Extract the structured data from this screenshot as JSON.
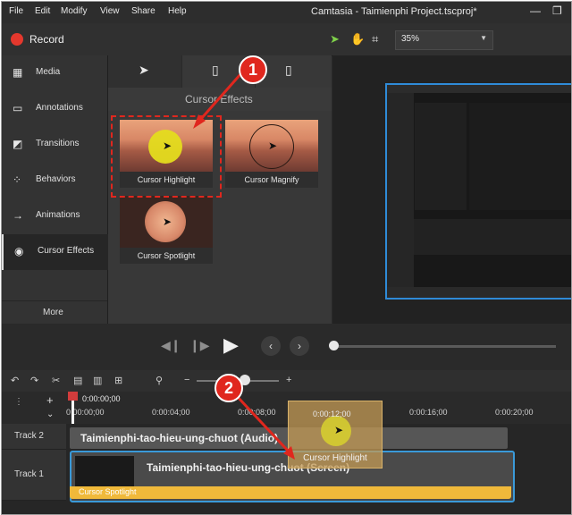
{
  "menubar": {
    "items": [
      "File",
      "Edit",
      "Modify",
      "View",
      "Share",
      "Help"
    ],
    "title": "Camtasia - Taimienphi Project.tscproj*",
    "controls": [
      "—",
      "❐"
    ]
  },
  "toolbar": {
    "record_label": "Record",
    "zoom_value": "35%",
    "tools": [
      "pointer-icon",
      "hand-icon",
      "crop-icon"
    ]
  },
  "sidebar": {
    "items": [
      {
        "label": "Media",
        "icon": "film-icon"
      },
      {
        "label": "Annotations",
        "icon": "annotation-icon"
      },
      {
        "label": "Transitions",
        "icon": "transition-icon"
      },
      {
        "label": "Behaviors",
        "icon": "behaviors-icon"
      },
      {
        "label": "Animations",
        "icon": "arrow-icon"
      },
      {
        "label": "Cursor Effects",
        "icon": "cursor-icon",
        "active": true
      }
    ],
    "more_label": "More"
  },
  "effects_panel": {
    "header": "Cursor Effects",
    "tabs": [
      "pointer-tab",
      "left-click-tab",
      "right-click-tab"
    ],
    "tiles": [
      {
        "label": "Cursor Highlight"
      },
      {
        "label": "Cursor Magnify"
      },
      {
        "label": "Cursor Spotlight"
      }
    ]
  },
  "timeline": {
    "playhead_time": "0:00:00;00",
    "ticks": [
      "0:00:00;00",
      "0:00:04;00",
      "0:00:08;00",
      "0:00:12;00",
      "0:00:16;00",
      "0:00:20;00"
    ],
    "drag_time": "0:00:12;00",
    "tracks": [
      {
        "name": "Track 2",
        "clip": "Taimienphi-tao-hieu-ung-chuot (Audio)"
      },
      {
        "name": "Track 1",
        "clip": "Taimienphi-tao-hieu-ung-chuot (Screen)",
        "effect": "Cursor Spotlight"
      }
    ],
    "drag_label": "Cursor Highlight"
  },
  "annotations": {
    "step1": "1",
    "step2": "2",
    "color": "#e0271e"
  }
}
